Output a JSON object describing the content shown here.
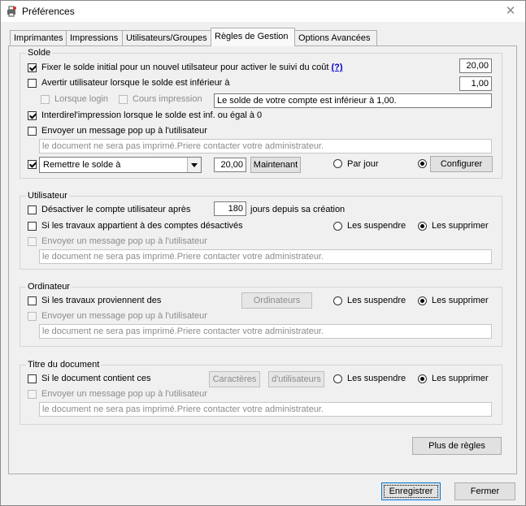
{
  "window": {
    "title": "Préférences"
  },
  "tabs": [
    {
      "label": "Imprimantes"
    },
    {
      "label": "Impressions"
    },
    {
      "label": "Utilisateurs/Groupes"
    },
    {
      "label": "Règles de Gestion"
    },
    {
      "label": "Options Avancées"
    }
  ],
  "active_tab": "Règles de Gestion",
  "solde": {
    "legend": "Solde",
    "fix_initial": {
      "label": "Fixer le solde initial pour un nouvel utilsateur pour activer le suivi du coût",
      "checked": true,
      "help": "(?)",
      "value": "20,00"
    },
    "warn": {
      "label": "Avertir utilisateur lorsque le solde est inférieur à",
      "checked": false,
      "value": "1,00"
    },
    "login": {
      "label": "Lorsque login",
      "checked": false
    },
    "print_run": {
      "label": "Cours impression",
      "checked": false
    },
    "warn_message": "Le solde de votre compte est inférieur à 1,00.",
    "forbid": {
      "label": "Interdirel'impression lorsque le solde est inf. ou égal à 0",
      "checked": true
    },
    "popup": {
      "label": "Envoyer un message pop up à l'utilisateur",
      "checked": false
    },
    "popup_message": "le document ne sera pas imprimé.Priere contacter votre administrateur.",
    "reset": {
      "checked": true,
      "select_value": "Remettre le solde à",
      "value": "20,00",
      "now_button": "Maintenant"
    },
    "per_day": {
      "label": "Par jour",
      "selected": false
    },
    "configure": {
      "label": "Configurer",
      "selected": true
    }
  },
  "utilisateur": {
    "legend": "Utilisateur",
    "disable": {
      "label": "Désactiver le compte utilisateur après",
      "checked": false,
      "value": "180",
      "suffix": "jours depuis sa création"
    },
    "jobs_disabled": {
      "label": "Si les travaux appartient à des comptes  désactivés",
      "checked": false
    },
    "suspend": {
      "label": "Les suspendre",
      "selected": false
    },
    "delete": {
      "label": "Les supprimer",
      "selected": true
    },
    "popup": {
      "label": "Envoyer un message pop up à l'utilisateur",
      "checked": false
    },
    "popup_message": "le document ne sera pas imprimé.Priere contacter votre administrateur."
  },
  "ordinateur": {
    "legend": "Ordinateur",
    "jobs_from": {
      "label": "Si les travaux proviennent des",
      "checked": false
    },
    "button": "Ordinateurs",
    "suspend": {
      "label": "Les suspendre",
      "selected": false
    },
    "delete": {
      "label": "Les supprimer",
      "selected": true
    },
    "popup": {
      "label": "Envoyer un message pop up à l'utilisateur",
      "checked": false
    },
    "popup_message": "le document ne sera pas imprimé.Priere contacter votre administrateur."
  },
  "titre": {
    "legend": "Titre du document",
    "contains": {
      "label": "Si le document contient ces",
      "checked": false
    },
    "chars_button": "Caractères",
    "users_button": "d'utilisateurs",
    "suspend": {
      "label": "Les suspendre",
      "selected": false
    },
    "delete": {
      "label": "Les supprimer",
      "selected": true
    },
    "popup": {
      "label": "Envoyer un message pop up à l'utilisateur",
      "checked": false
    },
    "popup_message": "le document ne sera pas imprimé.Priere contacter votre administrateur."
  },
  "more_rules_button": "Plus de règles",
  "footer": {
    "save": "Enregistrer",
    "close": "Fermer"
  },
  "icons": {
    "app": "printer-settings-icon",
    "close": "close-icon",
    "dropdown": "chevron-down-icon"
  }
}
